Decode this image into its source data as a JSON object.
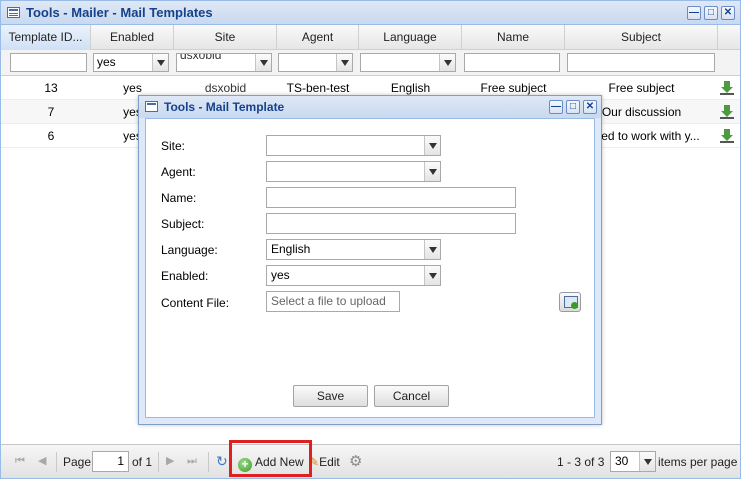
{
  "window": {
    "title": "Tools - Mailer - Mail Templates"
  },
  "grid": {
    "columns": [
      "Template ID...",
      "Enabled",
      "Site",
      "Agent",
      "Language",
      "Name",
      "Subject"
    ],
    "filters": {
      "enabled": "yes",
      "site": "dsxobid"
    },
    "rows": [
      {
        "id": "13",
        "enabled": "yes",
        "site": "dsxobid",
        "agent": "TS-ben-test",
        "language": "English",
        "name": "Free subject",
        "subject": "Free subject"
      },
      {
        "id": "7",
        "enabled": "yes",
        "site": "",
        "agent": "",
        "language": "",
        "name": "",
        "subject": "Our discussion"
      },
      {
        "id": "6",
        "enabled": "yes",
        "site": "",
        "agent": "",
        "language": "",
        "name": "",
        "subject": "xcited to work with y..."
      }
    ]
  },
  "paging": {
    "page_label": "Page",
    "page_value": "1",
    "of_label": "of 1",
    "add_new_label": "Add New",
    "edit_label": "Edit",
    "range_label": "1 - 3 of 3",
    "items_per_page_value": "30",
    "items_per_page_label": "items per page"
  },
  "dialog": {
    "title": "Tools - Mail Template",
    "fields": {
      "site_label": "Site:",
      "agent_label": "Agent:",
      "name_label": "Name:",
      "subject_label": "Subject:",
      "language_label": "Language:",
      "language_value": "English",
      "enabled_label": "Enabled:",
      "enabled_value": "yes",
      "content_file_label": "Content File:",
      "content_file_placeholder": "Select a file to upload"
    },
    "save_label": "Save",
    "cancel_label": "Cancel"
  },
  "colors": {
    "title_text": "#15428b",
    "highlight_border": "#e0201e"
  },
  "icons": [
    "window-icon",
    "minimize-icon",
    "maximize-icon",
    "close-icon",
    "chevron-down-icon",
    "download-icon",
    "first-page-icon",
    "prev-page-icon",
    "next-page-icon",
    "last-page-icon",
    "refresh-icon",
    "add-icon",
    "edit-icon",
    "settings-icon",
    "file-browse-icon"
  ]
}
